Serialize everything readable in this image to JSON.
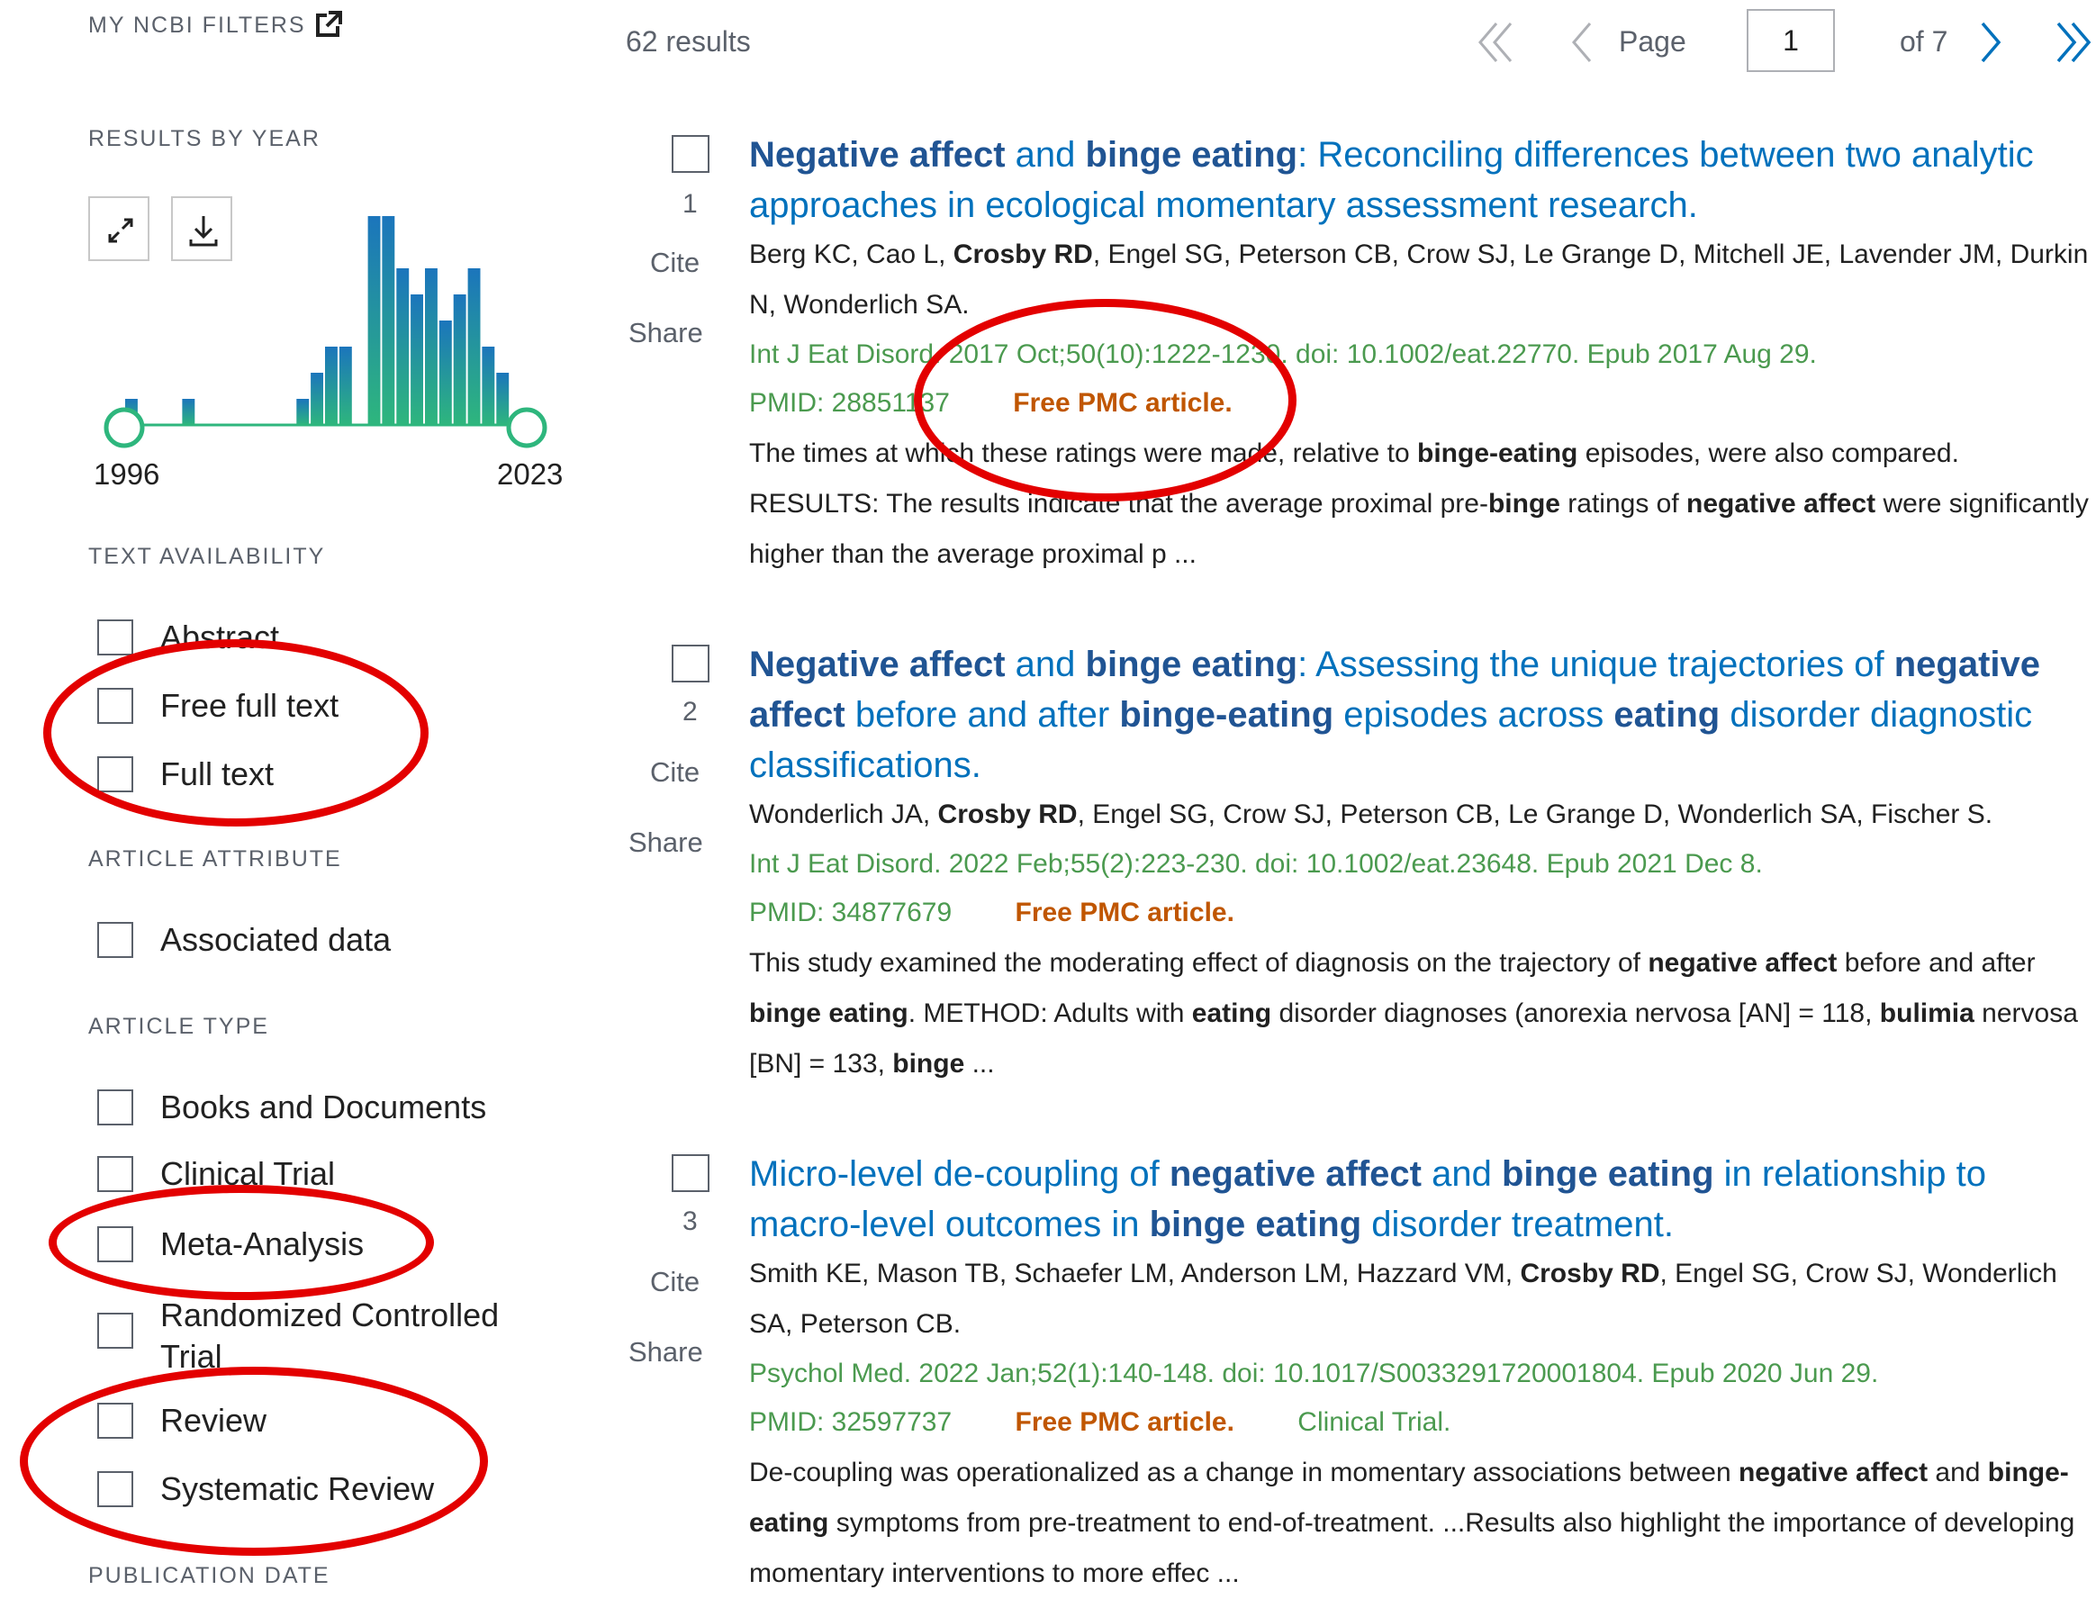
{
  "sidebar": {
    "my_ncbi_filters": "MY NCBI FILTERS",
    "results_by_year": "RESULTS BY YEAR",
    "year_start": "1996",
    "year_end": "2023",
    "text_availability": {
      "heading": "TEXT AVAILABILITY",
      "items": [
        "Abstract",
        "Free full text",
        "Full text"
      ]
    },
    "article_attribute": {
      "heading": "ARTICLE ATTRIBUTE",
      "items": [
        "Associated data"
      ]
    },
    "article_type": {
      "heading": "ARTICLE TYPE",
      "items": [
        "Books and Documents",
        "Clinical Trial",
        "Meta-Analysis",
        "Randomized Controlled Trial",
        "Review",
        "Systematic Review"
      ]
    },
    "publication_date": "PUBLICATION DATE"
  },
  "chart_data": {
    "type": "bar",
    "x_range": [
      1996,
      2023
    ],
    "values": [
      1,
      0,
      0,
      0,
      1,
      0,
      0,
      0,
      0,
      0,
      0,
      0,
      1,
      2,
      3,
      3,
      0,
      8,
      8,
      6,
      5,
      6,
      4,
      5,
      6,
      3,
      2,
      0
    ],
    "colors": [
      "#1b75bc",
      "#2eb67d"
    ]
  },
  "header": {
    "results_count": "62 results",
    "page_label": "Page",
    "page_value": "1",
    "page_of": "of 7"
  },
  "results": [
    {
      "num": "1",
      "cite": "Cite",
      "share": "Share",
      "title_html": "<b>Negative affect</b> and <b>binge eating</b>: Reconciling differences between two analytic approaches in ecological momentary assessment research.",
      "authors_html": "Berg KC, Cao L, <b>Crosby RD</b>, Engel SG, Peterson CB, Crow SJ, Le Grange D, Mitchell JE, Lavender JM, Durkin N, Wonderlich SA.",
      "citation": "Int J Eat Disord. 2017 Oct;50(10):1222-1230. doi: 10.1002/eat.22770. Epub 2017 Aug 29.",
      "pmid": "PMID: 28851137",
      "free": "Free PMC article.",
      "pub_type": "",
      "snippet_html": "The times at which these ratings were made, relative to <b>binge-eating</b> episodes, were also compared. RESULTS: The results indicate that the average proximal pre-<b>binge</b> ratings of <b>negative affect</b> were significantly higher than the average proximal p ..."
    },
    {
      "num": "2",
      "cite": "Cite",
      "share": "Share",
      "title_html": "<b>Negative affect</b> and <b>binge eating</b>: Assessing the unique trajectories of <b>negative affect</b> before and after <b>binge-eating</b> episodes across <b>eating</b> disorder diagnostic classifications.",
      "authors_html": "Wonderlich JA, <b>Crosby RD</b>, Engel SG, Crow SJ, Peterson CB, Le Grange D, Wonderlich SA, Fischer S.",
      "citation": "Int J Eat Disord. 2022 Feb;55(2):223-230. doi: 10.1002/eat.23648. Epub 2021 Dec 8.",
      "pmid": "PMID: 34877679",
      "free": "Free PMC article.",
      "pub_type": "",
      "snippet_html": "This study examined the moderating effect of diagnosis on the trajectory of <b>negative affect</b> before and after <b>binge eating</b>. METHOD: Adults with <b>eating</b> disorder diagnoses (anorexia nervosa [AN] = 118, <b>bulimia</b> nervosa [BN] = 133, <b>binge</b> ..."
    },
    {
      "num": "3",
      "cite": "Cite",
      "share": "Share",
      "title_html": "Micro-level de-coupling of <b>negative affect</b> and <b>binge eating</b> in relationship to macro-level outcomes in <b>binge eating</b> disorder treatment.",
      "authors_html": "Smith KE, Mason TB, Schaefer LM, Anderson LM, Hazzard VM, <b>Crosby RD</b>, Engel SG, Crow SJ, Wonderlich SA, Peterson CB.",
      "citation": "Psychol Med. 2022 Jan;52(1):140-148. doi: 10.1017/S0033291720001804. Epub 2020 Jun 29.",
      "pmid": "PMID: 32597737",
      "free": "Free PMC article.",
      "pub_type": "Clinical Trial.",
      "snippet_html": "De-coupling was operationalized as a change in momentary associations between <b>negative affect</b> and <b>binge-eating</b> symptoms from pre-treatment to end-of-treatment. ...Results also highlight the importance of developing momentary interventions to more effec ..."
    }
  ]
}
